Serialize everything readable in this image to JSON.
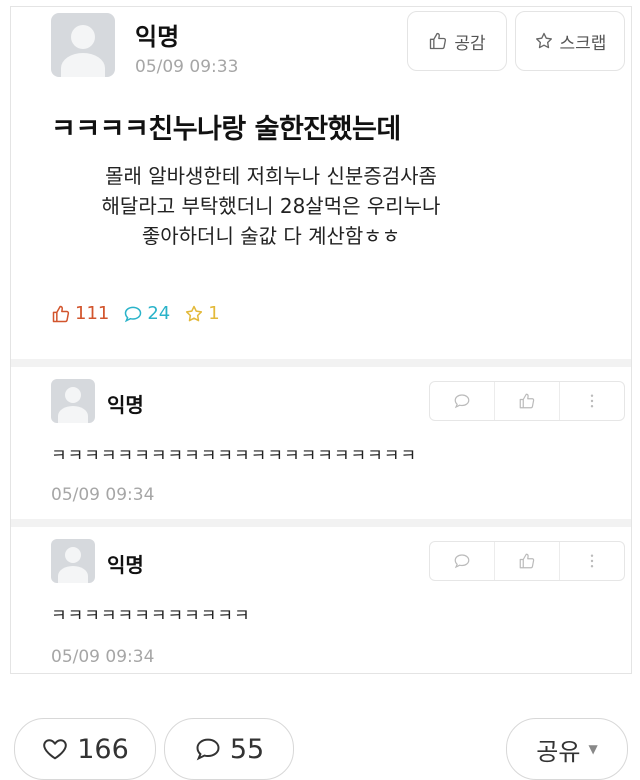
{
  "post": {
    "author": "익명",
    "time": "05/09 09:33",
    "like_button": "공감",
    "scrap_button": "스크랩",
    "title": "ㅋㅋㅋㅋ친누나랑 술한잔했는데",
    "body_lines": [
      "몰래 알바생한테 저희누나 신분증검사좀",
      "해달라고 부탁했더니 28살먹은 우리누나",
      "좋아하더니 술값 다 계산함ㅎㅎ"
    ],
    "stats": {
      "likes": "111",
      "comments": "24",
      "scraps": "1"
    }
  },
  "comments": [
    {
      "author": "익명",
      "text": "ㅋㅋㅋㅋㅋㅋㅋㅋㅋㅋㅋㅋㅋㅋㅋㅋㅋㅋㅋㅋㅋㅋ",
      "time": "05/09 09:34"
    },
    {
      "author": "익명",
      "text": "ㅋㅋㅋㅋㅋㅋㅋㅋㅋㅋㅋㅋ",
      "time": "05/09 09:34"
    }
  ],
  "bottom_bar": {
    "likes": "166",
    "comments": "55",
    "share_label": "공유"
  },
  "colors": {
    "like": "#d2552d",
    "comment": "#2ab3c9",
    "scrap": "#e3b93a",
    "muted": "#a6a6a6"
  }
}
